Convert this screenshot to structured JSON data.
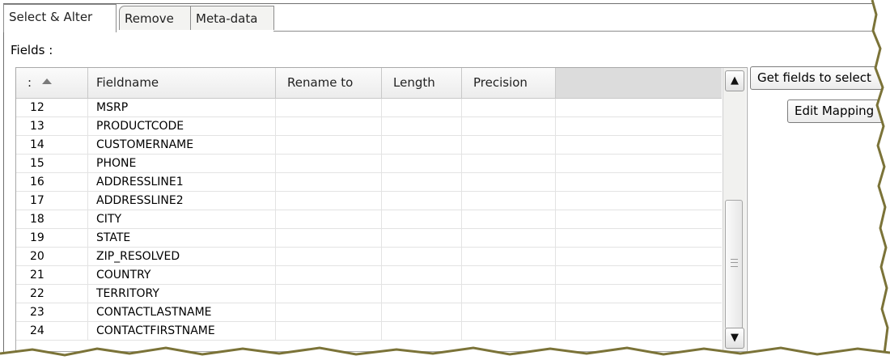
{
  "tabs": [
    {
      "label": "Select & Alter",
      "active": true
    },
    {
      "label": "Remove",
      "active": false
    },
    {
      "label": "Meta-data",
      "active": false
    }
  ],
  "fields_label": "Fields :",
  "table": {
    "columns": [
      {
        "label": ":",
        "sort_icon": "sort-up-icon"
      },
      {
        "label": "Fieldname"
      },
      {
        "label": "Rename to"
      },
      {
        "label": "Length"
      },
      {
        "label": "Precision"
      },
      {
        "label": ""
      }
    ],
    "rows": [
      {
        "num": "12",
        "fieldname": "MSRP",
        "rename_to": "",
        "length": "",
        "precision": ""
      },
      {
        "num": "13",
        "fieldname": "PRODUCTCODE",
        "rename_to": "",
        "length": "",
        "precision": ""
      },
      {
        "num": "14",
        "fieldname": "CUSTOMERNAME",
        "rename_to": "",
        "length": "",
        "precision": ""
      },
      {
        "num": "15",
        "fieldname": "PHONE",
        "rename_to": "",
        "length": "",
        "precision": ""
      },
      {
        "num": "16",
        "fieldname": "ADDRESSLINE1",
        "rename_to": "",
        "length": "",
        "precision": ""
      },
      {
        "num": "17",
        "fieldname": "ADDRESSLINE2",
        "rename_to": "",
        "length": "",
        "precision": ""
      },
      {
        "num": "18",
        "fieldname": "CITY",
        "rename_to": "",
        "length": "",
        "precision": ""
      },
      {
        "num": "19",
        "fieldname": "STATE",
        "rename_to": "",
        "length": "",
        "precision": ""
      },
      {
        "num": "20",
        "fieldname": "ZIP_RESOLVED",
        "rename_to": "",
        "length": "",
        "precision": ""
      },
      {
        "num": "21",
        "fieldname": "COUNTRY",
        "rename_to": "",
        "length": "",
        "precision": ""
      },
      {
        "num": "22",
        "fieldname": "TERRITORY",
        "rename_to": "",
        "length": "",
        "precision": ""
      },
      {
        "num": "23",
        "fieldname": "CONTACTLASTNAME",
        "rename_to": "",
        "length": "",
        "precision": ""
      },
      {
        "num": "24",
        "fieldname": "CONTACTFIRSTNAME",
        "rename_to": "",
        "length": "",
        "precision": ""
      }
    ]
  },
  "scrollbar": {
    "up_icon": "scroll-up-icon",
    "down_icon": "scroll-down-icon"
  },
  "buttons": {
    "get_fields": "Get fields to select",
    "edit_mapping": "Edit Mapping"
  }
}
